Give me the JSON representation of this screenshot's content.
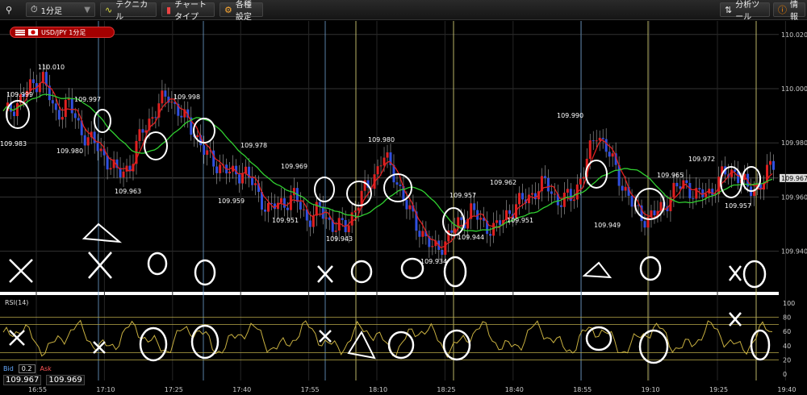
{
  "toolbar": {
    "timeframe": "1分足",
    "technical": "テクニカル",
    "chart_type": "チャートタイプ",
    "settings": "各種設定",
    "analysis_tools": "分析ツール",
    "info": "情報"
  },
  "pair_label": "USD/JPY 1分足",
  "current_price_tag": "109.967",
  "rsi_label": "RSI(14)",
  "bid_ask": {
    "bid_label": "Bid",
    "ask_label": "Ask",
    "spread": "0.2",
    "bid": "109.967",
    "ask": "109.969"
  },
  "colors": {
    "up": "#e02020",
    "down": "#3050e0",
    "ma_short": "#e02020",
    "ma_long": "#30d030",
    "rsi": "#c8b040"
  },
  "price_axis": [
    "110.020",
    "110.000",
    "109.980",
    "109.960",
    "109.940"
  ],
  "time_axis": [
    "16:55",
    "17:10",
    "17:25",
    "17:40",
    "17:55",
    "18:10",
    "18:25",
    "18:40",
    "18:55",
    "19:10",
    "19:25",
    "19:40"
  ],
  "rsi_axis": [
    "100",
    "80",
    "60",
    "40",
    "20",
    "0"
  ],
  "annotations": [
    "109.999",
    "110.010",
    "109.997",
    "109.983",
    "109.980",
    "109.963",
    "109.998",
    "109.978",
    "109.959",
    "109.969",
    "109.951",
    "109.943",
    "109.980",
    "109.934",
    "109.957",
    "109.944",
    "109.962",
    "109.951",
    "109.990",
    "109.949",
    "109.965",
    "109.972",
    "109.957"
  ],
  "chart_data": {
    "type": "candlestick",
    "ylim": [
      109.925,
      110.025
    ],
    "rsi_levels": [
      80,
      70,
      30,
      20
    ]
  }
}
